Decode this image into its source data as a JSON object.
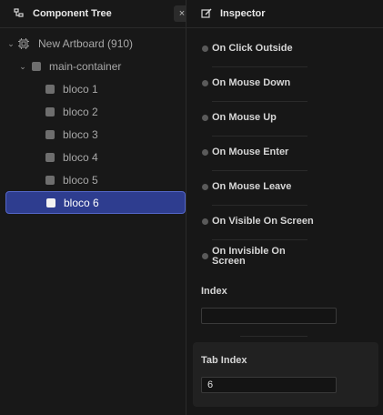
{
  "left": {
    "title": "Component Tree",
    "close": "×",
    "tree": [
      {
        "label": "New Artboard (910)",
        "level": 0
      },
      {
        "label": "main-container",
        "level": 1
      },
      {
        "label": "bloco 1",
        "level": 2
      },
      {
        "label": "bloco 2",
        "level": 2
      },
      {
        "label": "bloco 3",
        "level": 2
      },
      {
        "label": "bloco 4",
        "level": 2
      },
      {
        "label": "bloco 5",
        "level": 2
      },
      {
        "label": "bloco 6",
        "level": 2,
        "selected": true
      }
    ]
  },
  "right": {
    "title": "Inspector",
    "events": [
      "On Click Outside",
      "On Mouse Down",
      "On Mouse Up",
      "On Mouse Enter",
      "On Mouse Leave",
      "On Visible On Screen",
      "On Invisible On",
      "Screen"
    ],
    "index_label": "Index",
    "index_value": "",
    "tab_index_label": "Tab Index",
    "tab_index_value": "6"
  },
  "colors": {
    "selection": "#2e3d8f",
    "selection_border": "#5466c7",
    "background": "#1a1a1a"
  }
}
